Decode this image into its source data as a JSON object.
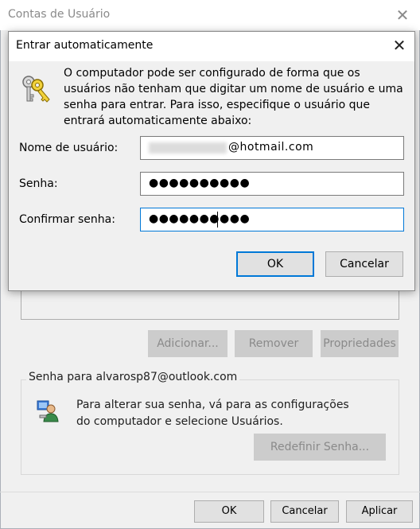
{
  "background_window": {
    "title": "Contas de Usuário",
    "buttons": {
      "add": "Adicionar...",
      "remove": "Remover",
      "properties": "Propriedades"
    },
    "password_group": {
      "title": "Senha para alvarosp87@outlook.com",
      "text": "Para alterar sua senha, vá para as configurações do computador e selecione Usuários.",
      "reset_button": "Redefinir Senha..."
    },
    "footer": {
      "ok": "OK",
      "cancel": "Cancelar",
      "apply": "Aplicar"
    }
  },
  "dialog": {
    "title": "Entrar automaticamente",
    "description": "O computador pode ser configurado de forma que os usuários não tenham que digitar um nome de usuário e uma senha para entrar. Para isso, especifique o usuário que entrará automaticamente abaixo:",
    "labels": {
      "username": "Nome de usuário:",
      "password": "Senha:",
      "confirm": "Confirmar senha:"
    },
    "values": {
      "username_domain": "@hotmail.com",
      "password": "●●●●●●●●●●",
      "confirm": "●●●●●●●●●●"
    },
    "buttons": {
      "ok": "OK",
      "cancel": "Cancelar"
    }
  },
  "icons": {
    "close": "close-icon",
    "keys": "keys-icon",
    "user_key": "user-key-icon"
  }
}
